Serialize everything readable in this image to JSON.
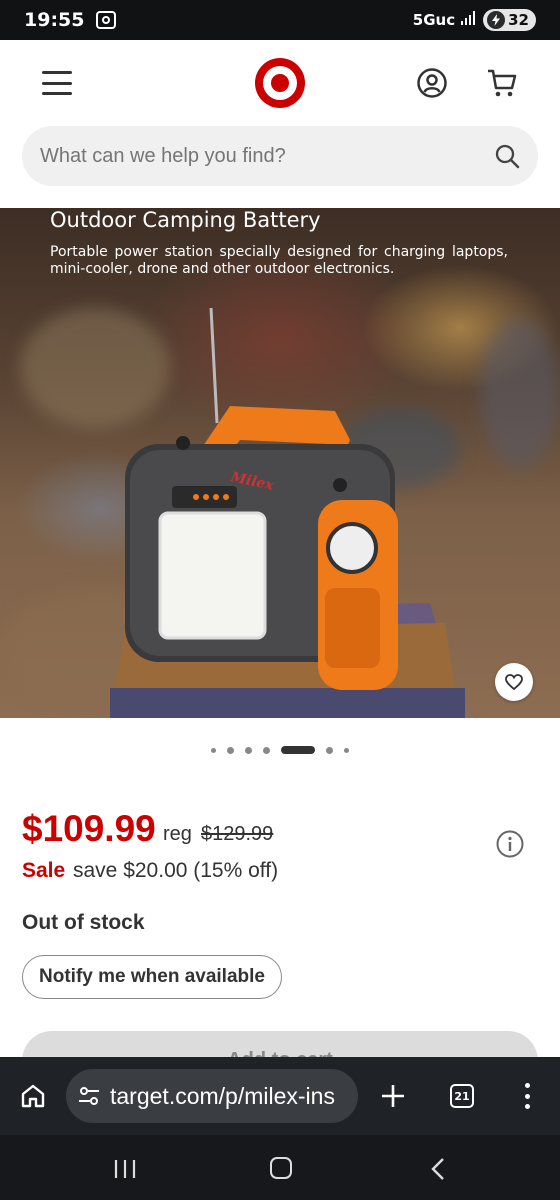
{
  "status_bar": {
    "time": "19:55",
    "network": "5Guc",
    "battery": "32"
  },
  "header": {
    "menu_icon": "hamburger-menu-icon",
    "logo": "target-bullseye-logo",
    "account_icon": "account-icon",
    "cart_icon": "cart-icon"
  },
  "search": {
    "placeholder": "What can we help you find?",
    "icon": "search-icon"
  },
  "hero": {
    "title": "Outdoor Camping Battery",
    "description": "Portable power station specially designed for charging laptops, mini-cooler, drone and other outdoor electronics.",
    "brand_mark": "Milex"
  },
  "carousel": {
    "total_dots": 7,
    "active_index": 4
  },
  "pricing": {
    "price": "$109.99",
    "reg_label": "reg",
    "reg_price": "$129.99",
    "sale_label": "Sale",
    "save_text": "save $20.00 (15% off)"
  },
  "availability": {
    "status": "Out of stock",
    "notify_label": "Notify me when available",
    "add_to_cart_label": "Add to cart"
  },
  "browser": {
    "url": "target.com/p/milex-ins",
    "tab_count": "21"
  },
  "colors": {
    "target_red": "#cc0000",
    "sale_red": "#cc0000",
    "browser_bg": "#1f2226",
    "url_pill": "#3a3d42"
  }
}
